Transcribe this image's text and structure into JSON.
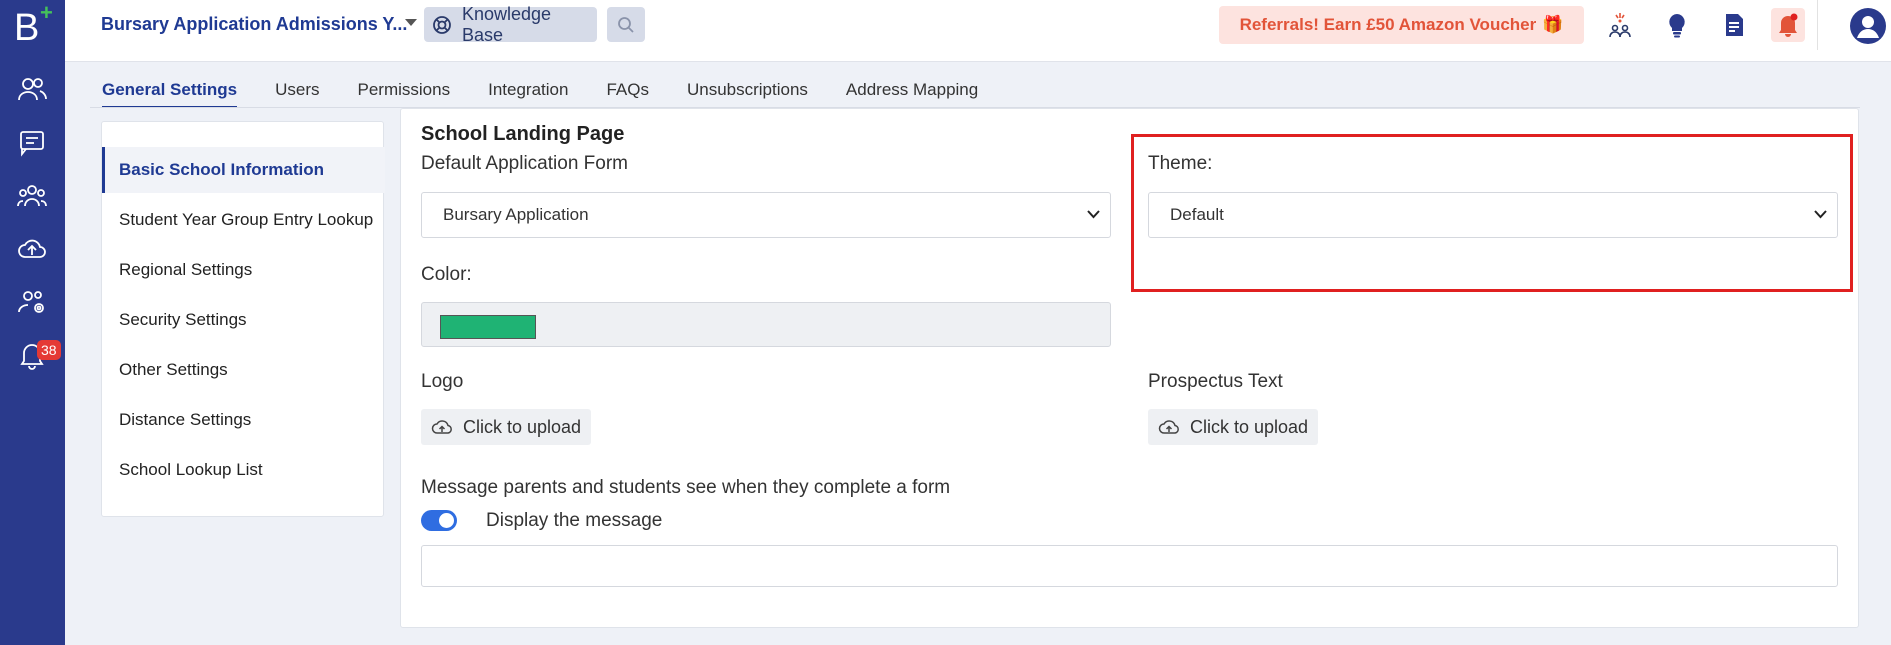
{
  "rail": {
    "logo_letter": "B",
    "logo_plus": "+",
    "notification_count": "38"
  },
  "header": {
    "app_title": "Bursary Application Admissions Y...",
    "knowledge_base_label": "Knowledge Base",
    "referral_text": "Referrals! Earn £50 Amazon Voucher",
    "referral_gift": "🎁"
  },
  "tabs": [
    {
      "label": "General Settings",
      "active": true
    },
    {
      "label": "Users"
    },
    {
      "label": "Permissions"
    },
    {
      "label": "Integration"
    },
    {
      "label": "FAQs"
    },
    {
      "label": "Unsubscriptions"
    },
    {
      "label": "Address Mapping"
    }
  ],
  "side_menu": [
    {
      "label": "Basic School Information",
      "active": true
    },
    {
      "label": "Student Year Group Entry Lookup"
    },
    {
      "label": "Regional Settings"
    },
    {
      "label": "Security Settings"
    },
    {
      "label": "Other Settings"
    },
    {
      "label": "Distance Settings"
    },
    {
      "label": "School Lookup List"
    }
  ],
  "main": {
    "section_title": "School Landing Page",
    "default_form_label": "Default Application Form",
    "default_form_value": "Bursary Application",
    "theme_label": "Theme:",
    "theme_value": "Default",
    "color_label": "Color:",
    "color_value": "#1fb374",
    "logo_label": "Logo",
    "logo_upload": "Click to upload",
    "prospectus_label": "Prospectus Text",
    "prospectus_upload": "Click to upload",
    "message_label": "Message parents and students see when they complete a form",
    "display_message_label": "Display the message",
    "display_message_enabled": true,
    "message_value": ""
  },
  "colors": {
    "rail": "#2a3a8c",
    "accent": "#1f3a93",
    "highlight": "#e02020",
    "referral_text": "#e25439"
  }
}
